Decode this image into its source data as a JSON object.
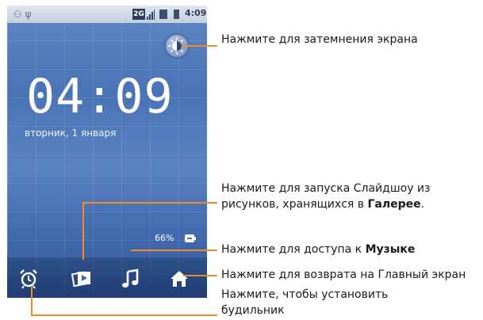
{
  "status_bar": {
    "time": "4:09",
    "network": "2G"
  },
  "lock_screen": {
    "clock": "04:09",
    "date": "вторник, 1 января",
    "battery_level": "66%"
  },
  "dock": {
    "icons": [
      "alarm-clock-icon",
      "gallery-slideshow-icon",
      "music-note-icon",
      "home-icon"
    ]
  },
  "callouts": {
    "brightness": {
      "text": "Нажмите для затемнения экрана"
    },
    "slideshow": {
      "text": "Нажмите для запуска Слайдшоу из рисунков, хранящихся в",
      "bold": "Галерее",
      "suffix": "."
    },
    "music": {
      "text": "Нажмите для доступа к",
      "bold": "Музыке"
    },
    "home": {
      "text": "Нажмите для возврата на Главный экран"
    },
    "alarm": {
      "text": "Нажмите, чтобы установить будильник"
    }
  },
  "colors": {
    "callout_line": "#f08a24",
    "wallpaper": "#4a73b6"
  }
}
